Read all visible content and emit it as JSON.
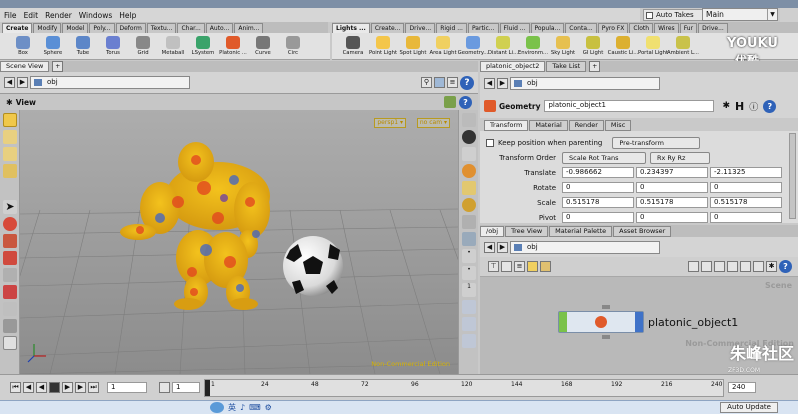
{
  "menu": [
    "File",
    "Edit",
    "Render",
    "Windows",
    "Help"
  ],
  "auto_takes": "Auto Takes",
  "desktop": "Main",
  "shelf_tabs_left": [
    "Create",
    "Modify",
    "Model",
    "Poly...",
    "Deform",
    "Textu...",
    "Char...",
    "Auto...",
    "Anim..."
  ],
  "shelf_tabs_right": [
    "Lights ...",
    "Create...",
    "Drive...",
    "Rigid ...",
    "Partic...",
    "Fluid ...",
    "Popula...",
    "Conta...",
    "Pyro FX",
    "Cloth",
    "Wires",
    "Fur",
    "Drive..."
  ],
  "tools_left": [
    "Box",
    "Sphere",
    "Tube",
    "Torus",
    "Grid",
    "Metaball",
    "LSystem",
    "Platonic ...",
    "Curve",
    "Circ"
  ],
  "tools_right": [
    "Camera",
    "Point Light",
    "Spot Light",
    "Area Light",
    "Geometry...",
    "Distant Li...",
    "Environm...",
    "Sky Light",
    "GI Light",
    "Caustic Li...",
    "Portal Light",
    "Ambient L..."
  ],
  "watermark_top": "YOUKU",
  "watermark_top2": "优酷",
  "scene": {
    "tab": "Scene View",
    "path": "obj",
    "view_label": "View",
    "persp": "persp1 ▾",
    "cam": "no cam ▾",
    "noncommercial": "Non-Commercial Edition"
  },
  "params": {
    "tabs": [
      "platonic_object2",
      "Take List"
    ],
    "node_type": "Geometry",
    "node_name": "platonic_object1",
    "subtabs": [
      "Transform",
      "Material",
      "Render",
      "Misc"
    ],
    "keep_position": "Keep position when parenting",
    "pre_transform": "Pre-transform",
    "transform_order_label": "Transform Order",
    "transform_order": "Scale Rot Trans",
    "rot_order": "Rx Ry Rz",
    "rows": [
      {
        "label": "Translate",
        "v": [
          "-0.986662",
          "0.234397",
          "-2.11325"
        ]
      },
      {
        "label": "Rotate",
        "v": [
          "0",
          "0",
          "0"
        ]
      },
      {
        "label": "Scale",
        "v": [
          "0.515178",
          "0.515178",
          "0.515178"
        ]
      },
      {
        "label": "Pivot",
        "v": [
          "0",
          "0",
          "0"
        ]
      }
    ]
  },
  "network": {
    "tabs": [
      "/obj",
      "Tree View",
      "Material Palette",
      "Asset Browser"
    ],
    "path": "obj",
    "scene_label": "Scene",
    "node_label": "platonic_object1",
    "noncommercial": "Non-Commercial Edition",
    "watermark": "朱峰社区",
    "watermark_sub": "ZF3D.COM"
  },
  "timeline": {
    "frame": "1",
    "start": "1",
    "ticks": [
      "1",
      "24",
      "48",
      "72",
      "96",
      "120",
      "144",
      "168",
      "192",
      "216",
      "240"
    ],
    "end": "240",
    "auto_update": "Auto Update"
  },
  "taskbar": [
    "英",
    "♪",
    "⌨",
    "⚙"
  ]
}
